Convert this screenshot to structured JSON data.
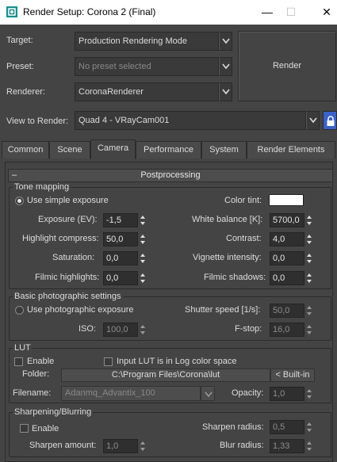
{
  "window": {
    "title": "Render Setup: Corona 2 (Final)",
    "minimize": "—",
    "maximize": "☐",
    "close": "✕"
  },
  "header": {
    "target_label": "Target:",
    "target_value": "Production Rendering Mode",
    "preset_label": "Preset:",
    "preset_value": "No preset selected",
    "renderer_label": "Renderer:",
    "renderer_value": "CoronaRenderer",
    "view_label": "View to Render:",
    "view_value": "Quad 4 - VRayCam001",
    "render_button": "Render"
  },
  "tabs": [
    {
      "label": "Common",
      "active": false
    },
    {
      "label": "Scene",
      "active": false
    },
    {
      "label": "Camera",
      "active": true
    },
    {
      "label": "Performance",
      "active": false
    },
    {
      "label": "System",
      "active": false
    },
    {
      "label": "Render Elements",
      "active": false
    }
  ],
  "rollout": {
    "title": "Postprocessing",
    "collapse_symbol": "–"
  },
  "tone_mapping": {
    "title": "Tone mapping",
    "simple_exposure_label": "Use simple exposure",
    "simple_exposure_selected": true,
    "color_tint_label": "Color tint:",
    "color_tint_value": "#ffffff",
    "exposure_label": "Exposure (EV):",
    "exposure_value": "-1,5",
    "white_balance_label": "White balance [K]:",
    "white_balance_value": "5700,0",
    "highlight_label": "Highlight compress:",
    "highlight_value": "50,0",
    "contrast_label": "Contrast:",
    "contrast_value": "4,0",
    "saturation_label": "Saturation:",
    "saturation_value": "0,0",
    "vignette_label": "Vignette intensity:",
    "vignette_value": "0,0",
    "filmic_highlights_label": "Filmic highlights:",
    "filmic_highlights_value": "0,0",
    "filmic_shadows_label": "Filmic shadows:",
    "filmic_shadows_value": "0,0"
  },
  "photographic": {
    "title": "Basic photographic settings",
    "use_photo_label": "Use photographic exposure",
    "use_photo_selected": false,
    "shutter_label": "Shutter speed [1/s]:",
    "shutter_value": "50,0",
    "iso_label": "ISO:",
    "iso_value": "100,0",
    "fstop_label": "F-stop:",
    "fstop_value": "16,0"
  },
  "lut": {
    "title": "LUT",
    "enable_label": "Enable",
    "enable_checked": false,
    "log_label": "Input LUT is in Log color space",
    "log_checked": false,
    "folder_label": "Folder:",
    "folder_value": "C:\\Program Files\\Corona\\lut",
    "builtin_button": "< Built-in",
    "filename_label": "Filename:",
    "filename_value": "Adanmq_Advantix_100",
    "opacity_label": "Opacity:",
    "opacity_value": "1,0"
  },
  "sharpen": {
    "title": "Sharpening/Blurring",
    "enable_label": "Enable",
    "enable_checked": false,
    "sharpen_radius_label": "Sharpen radius:",
    "sharpen_radius_value": "0,5",
    "sharpen_amount_label": "Sharpen amount:",
    "sharpen_amount_value": "1,0",
    "blur_radius_label": "Blur radius:",
    "blur_radius_value": "1,33"
  }
}
